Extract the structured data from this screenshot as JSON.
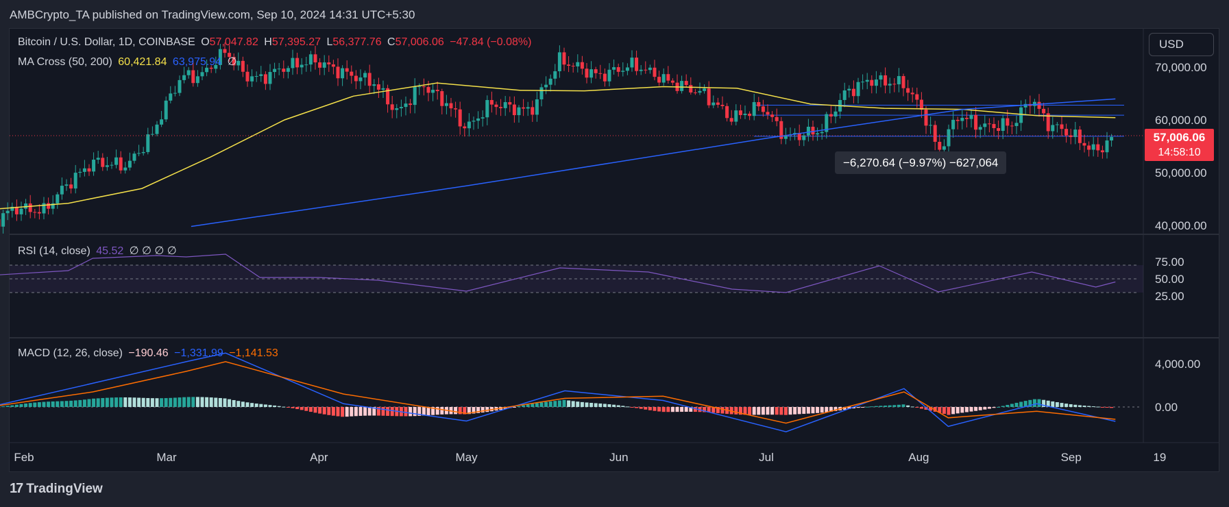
{
  "publisher": "AMBCrypto_TA published on TradingView.com, Sep 10, 2024 14:31 UTC+5:30",
  "footer": {
    "brand": "TradingView"
  },
  "currency_button": "USD",
  "price_tag": {
    "price": "57,006.06",
    "countdown": "14:58:10"
  },
  "measure_label": "−6,270.64 (−9.97%) −627,064",
  "legend": {
    "symbol": "Bitcoin / U.S. Dollar, 1D, COINBASE",
    "o_label": "O",
    "o": "57,047.82",
    "h_label": "H",
    "h": "57,395.27",
    "l_label": "L",
    "l": "56,377.76",
    "c_label": "C",
    "c": "57,006.06",
    "change": "−47.84 (−0.08%)",
    "ma_label": "MA Cross (50, 200)",
    "ma50": "60,421.84",
    "ma200": "63,975.94",
    "ma_extra": "∅",
    "rsi_label": "RSI (14, close)",
    "rsi": "45.52",
    "rsi_extra": "∅  ∅  ∅  ∅",
    "macd_label": "MACD (12, 26, close)",
    "macd_hist": "−190.46",
    "macd": "−1,331.99",
    "macd_signal": "−1,141.53"
  },
  "colors": {
    "up": "#26a69a",
    "down": "#f23645",
    "ma50": "#f5e14a",
    "ma200": "#2962ff",
    "rsi": "#7e57c2",
    "macd": "#2962ff",
    "signal": "#ff6d00",
    "hist_up": "#26a69a",
    "hist_up_light": "#b2dfdb",
    "hist_down": "#ff5252",
    "hist_down_light": "#ffcdd2"
  },
  "chart_data": {
    "type": "candlestick",
    "price_axis_labels": [
      "70,000.00",
      "60,000.00",
      "50,000.00",
      "40,000.00"
    ],
    "rsi_axis_labels": [
      "75.00",
      "50.00",
      "25.00"
    ],
    "macd_axis_labels": [
      "4,000.00",
      "0.00"
    ],
    "x_tick_labels": [
      "Feb",
      "Mar",
      "Apr",
      "May",
      "Jun",
      "Jul",
      "Aug",
      "Sep",
      "19"
    ],
    "close_series": [
      {
        "date": "2024-01-25",
        "close": 40000
      },
      {
        "date": "2024-01-30",
        "close": 43300
      },
      {
        "date": "2024-02-05",
        "close": 42700
      },
      {
        "date": "2024-02-09",
        "close": 47100
      },
      {
        "date": "2024-02-15",
        "close": 52000
      },
      {
        "date": "2024-02-22",
        "close": 51300
      },
      {
        "date": "2024-02-27",
        "close": 57000
      },
      {
        "date": "2024-02-29",
        "close": 61200
      },
      {
        "date": "2024-03-04",
        "close": 68300
      },
      {
        "date": "2024-03-08",
        "close": 68300
      },
      {
        "date": "2024-03-13",
        "close": 73100
      },
      {
        "date": "2024-03-17",
        "close": 68400
      },
      {
        "date": "2024-03-20",
        "close": 67800
      },
      {
        "date": "2024-03-25",
        "close": 70000
      },
      {
        "date": "2024-03-31",
        "close": 71300
      },
      {
        "date": "2024-04-06",
        "close": 68900
      },
      {
        "date": "2024-04-12",
        "close": 67200
      },
      {
        "date": "2024-04-17",
        "close": 61300
      },
      {
        "date": "2024-04-22",
        "close": 66800
      },
      {
        "date": "2024-04-27",
        "close": 63100
      },
      {
        "date": "2024-05-01",
        "close": 58300
      },
      {
        "date": "2024-05-06",
        "close": 63100
      },
      {
        "date": "2024-05-14",
        "close": 61600
      },
      {
        "date": "2024-05-20",
        "close": 71400
      },
      {
        "date": "2024-05-28",
        "close": 68300
      },
      {
        "date": "2024-06-04",
        "close": 70500
      },
      {
        "date": "2024-06-11",
        "close": 67300
      },
      {
        "date": "2024-06-18",
        "close": 65100
      },
      {
        "date": "2024-06-24",
        "close": 60300
      },
      {
        "date": "2024-06-30",
        "close": 62700
      },
      {
        "date": "2024-07-05",
        "close": 56700
      },
      {
        "date": "2024-07-12",
        "close": 57900
      },
      {
        "date": "2024-07-17",
        "close": 65100
      },
      {
        "date": "2024-07-22",
        "close": 67600
      },
      {
        "date": "2024-07-29",
        "close": 66800
      },
      {
        "date": "2024-08-02",
        "close": 61400
      },
      {
        "date": "2024-08-05",
        "close": 54000
      },
      {
        "date": "2024-08-09",
        "close": 60900
      },
      {
        "date": "2024-08-14",
        "close": 58700
      },
      {
        "date": "2024-08-20",
        "close": 59100
      },
      {
        "date": "2024-08-24",
        "close": 64200
      },
      {
        "date": "2024-08-27",
        "close": 59400
      },
      {
        "date": "2024-09-01",
        "close": 57300
      },
      {
        "date": "2024-09-06",
        "close": 53900
      },
      {
        "date": "2024-09-10",
        "close": 57006
      }
    ],
    "ma50_series": [
      {
        "date": "2024-01-25",
        "v": 43000
      },
      {
        "date": "2024-02-10",
        "v": 44200
      },
      {
        "date": "2024-02-25",
        "v": 47000
      },
      {
        "date": "2024-03-10",
        "v": 53000
      },
      {
        "date": "2024-03-25",
        "v": 60000
      },
      {
        "date": "2024-04-08",
        "v": 64500
      },
      {
        "date": "2024-04-25",
        "v": 67000
      },
      {
        "date": "2024-05-12",
        "v": 65600
      },
      {
        "date": "2024-05-25",
        "v": 65500
      },
      {
        "date": "2024-06-10",
        "v": 66300
      },
      {
        "date": "2024-06-25",
        "v": 66000
      },
      {
        "date": "2024-07-10",
        "v": 63000
      },
      {
        "date": "2024-07-25",
        "v": 62200
      },
      {
        "date": "2024-08-10",
        "v": 62000
      },
      {
        "date": "2024-08-25",
        "v": 60800
      },
      {
        "date": "2024-09-10",
        "v": 60421.84
      }
    ],
    "ma200_series": [
      {
        "date": "2024-03-06",
        "v": 39800
      },
      {
        "date": "2024-05-01",
        "v": 47500
      },
      {
        "date": "2024-07-01",
        "v": 56500
      },
      {
        "date": "2024-08-10",
        "v": 62000
      },
      {
        "date": "2024-09-10",
        "v": 63975.94
      }
    ],
    "rsi_series": [
      {
        "date": "2024-01-25",
        "v": 55
      },
      {
        "date": "2024-02-10",
        "v": 62
      },
      {
        "date": "2024-02-15",
        "v": 80
      },
      {
        "date": "2024-02-28",
        "v": 84
      },
      {
        "date": "2024-03-05",
        "v": 82
      },
      {
        "date": "2024-03-13",
        "v": 86
      },
      {
        "date": "2024-03-20",
        "v": 52
      },
      {
        "date": "2024-04-01",
        "v": 52
      },
      {
        "date": "2024-04-13",
        "v": 48
      },
      {
        "date": "2024-05-01",
        "v": 32
      },
      {
        "date": "2024-05-20",
        "v": 66
      },
      {
        "date": "2024-06-07",
        "v": 60
      },
      {
        "date": "2024-06-24",
        "v": 35
      },
      {
        "date": "2024-07-05",
        "v": 30
      },
      {
        "date": "2024-07-24",
        "v": 69
      },
      {
        "date": "2024-08-05",
        "v": 31
      },
      {
        "date": "2024-08-24",
        "v": 60
      },
      {
        "date": "2024-09-06",
        "v": 38
      },
      {
        "date": "2024-09-10",
        "v": 45.52
      }
    ],
    "macd_series": [
      {
        "date": "2024-01-25",
        "macd": 0,
        "signal": 0
      },
      {
        "date": "2024-02-15",
        "macd": 2200,
        "signal": 1400
      },
      {
        "date": "2024-03-05",
        "macd": 4200,
        "signal": 3300
      },
      {
        "date": "2024-03-13",
        "macd": 5000,
        "signal": 4200
      },
      {
        "date": "2024-04-06",
        "macd": 300,
        "signal": 1200
      },
      {
        "date": "2024-05-01",
        "macd": -1300,
        "signal": -600
      },
      {
        "date": "2024-05-21",
        "macd": 1500,
        "signal": 800
      },
      {
        "date": "2024-06-10",
        "macd": 600,
        "signal": 1000
      },
      {
        "date": "2024-07-05",
        "macd": -2300,
        "signal": -1500
      },
      {
        "date": "2024-07-29",
        "macd": 1700,
        "signal": 1400
      },
      {
        "date": "2024-08-07",
        "macd": -1800,
        "signal": -1000
      },
      {
        "date": "2024-08-25",
        "macd": 300,
        "signal": -400
      },
      {
        "date": "2024-09-10",
        "macd": -1331.99,
        "signal": -1141.53
      }
    ]
  }
}
